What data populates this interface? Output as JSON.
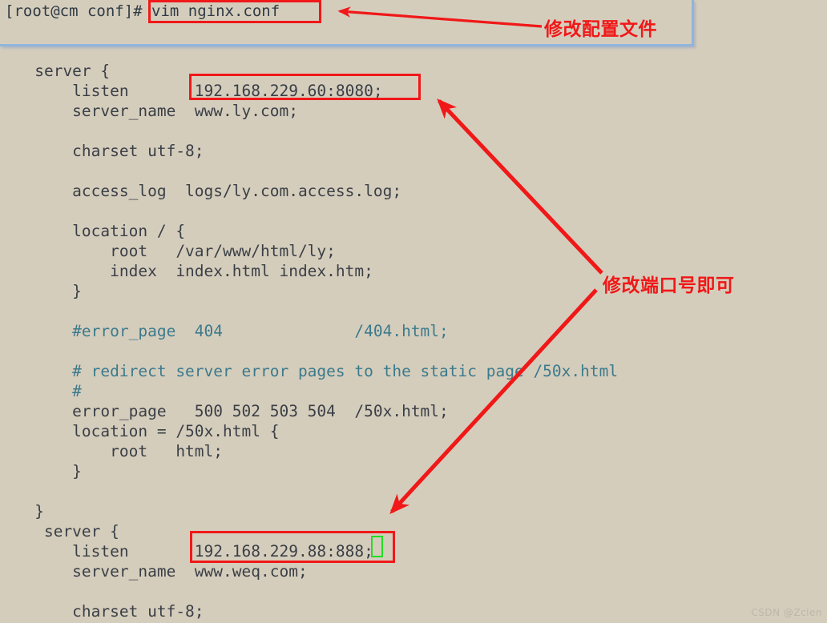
{
  "terminal": {
    "prompt": "[root@cm conf]# ",
    "command": "vim nginx.conf"
  },
  "config": {
    "lines": [
      "   server {",
      "       listen       192.168.229.60:8080;",
      "       server_name  www.ly.com;",
      "",
      "       charset utf-8;",
      "",
      "       access_log  logs/ly.com.access.log;",
      "",
      "       location / {",
      "           root   /var/www/html/ly;",
      "           index  index.html index.htm;",
      "       }",
      "",
      "       #error_page  404              /404.html;",
      "",
      "       # redirect server error pages to the static page /50x.html",
      "       #",
      "       error_page   500 502 503 504  /50x.html;",
      "       location = /50x.html {",
      "           root   html;",
      "       }",
      "",
      "   }",
      "    server {",
      "       listen       192.168.229.88:888;",
      "       server_name  www.weq.com;",
      "",
      "       charset utf-8;"
    ],
    "comment_line_indexes": [
      13,
      15,
      16
    ]
  },
  "annotations": {
    "label_1": "修改配置文件",
    "label_2": "修改端口号即可"
  },
  "highlights": {
    "command_box_label": "vim nginx.conf",
    "listen_box_1_label": "192.168.229.60:8080;",
    "listen_box_2_label": "192.168.229.88:888;"
  },
  "colors": {
    "background": "#d5cdbc",
    "text": "#3a3f46",
    "comment": "#3b7a8c",
    "annotation_red": "#f01818",
    "window_border_blue": "#8fb4de",
    "cursor_green": "#22dd22"
  },
  "watermark": "CSDN @Zcien"
}
